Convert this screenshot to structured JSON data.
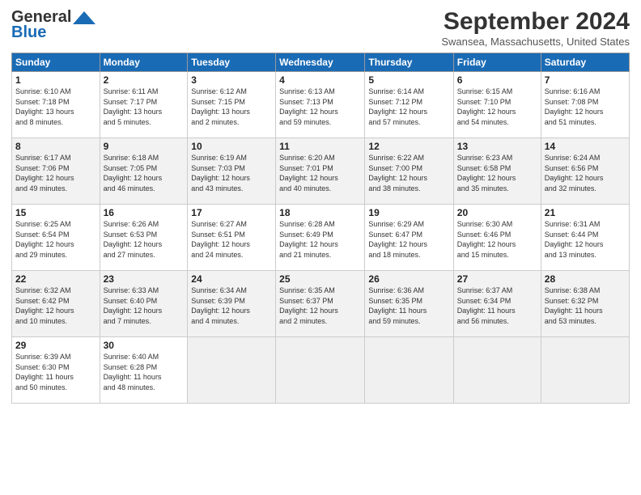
{
  "logo": {
    "line1": "General",
    "line2": "Blue"
  },
  "title": "September 2024",
  "subtitle": "Swansea, Massachusetts, United States",
  "weekdays": [
    "Sunday",
    "Monday",
    "Tuesday",
    "Wednesday",
    "Thursday",
    "Friday",
    "Saturday"
  ],
  "weeks": [
    [
      {
        "day": "1",
        "info": "Sunrise: 6:10 AM\nSunset: 7:18 PM\nDaylight: 13 hours\nand 8 minutes."
      },
      {
        "day": "2",
        "info": "Sunrise: 6:11 AM\nSunset: 7:17 PM\nDaylight: 13 hours\nand 5 minutes."
      },
      {
        "day": "3",
        "info": "Sunrise: 6:12 AM\nSunset: 7:15 PM\nDaylight: 13 hours\nand 2 minutes."
      },
      {
        "day": "4",
        "info": "Sunrise: 6:13 AM\nSunset: 7:13 PM\nDaylight: 12 hours\nand 59 minutes."
      },
      {
        "day": "5",
        "info": "Sunrise: 6:14 AM\nSunset: 7:12 PM\nDaylight: 12 hours\nand 57 minutes."
      },
      {
        "day": "6",
        "info": "Sunrise: 6:15 AM\nSunset: 7:10 PM\nDaylight: 12 hours\nand 54 minutes."
      },
      {
        "day": "7",
        "info": "Sunrise: 6:16 AM\nSunset: 7:08 PM\nDaylight: 12 hours\nand 51 minutes."
      }
    ],
    [
      {
        "day": "8",
        "info": "Sunrise: 6:17 AM\nSunset: 7:06 PM\nDaylight: 12 hours\nand 49 minutes."
      },
      {
        "day": "9",
        "info": "Sunrise: 6:18 AM\nSunset: 7:05 PM\nDaylight: 12 hours\nand 46 minutes."
      },
      {
        "day": "10",
        "info": "Sunrise: 6:19 AM\nSunset: 7:03 PM\nDaylight: 12 hours\nand 43 minutes."
      },
      {
        "day": "11",
        "info": "Sunrise: 6:20 AM\nSunset: 7:01 PM\nDaylight: 12 hours\nand 40 minutes."
      },
      {
        "day": "12",
        "info": "Sunrise: 6:22 AM\nSunset: 7:00 PM\nDaylight: 12 hours\nand 38 minutes."
      },
      {
        "day": "13",
        "info": "Sunrise: 6:23 AM\nSunset: 6:58 PM\nDaylight: 12 hours\nand 35 minutes."
      },
      {
        "day": "14",
        "info": "Sunrise: 6:24 AM\nSunset: 6:56 PM\nDaylight: 12 hours\nand 32 minutes."
      }
    ],
    [
      {
        "day": "15",
        "info": "Sunrise: 6:25 AM\nSunset: 6:54 PM\nDaylight: 12 hours\nand 29 minutes."
      },
      {
        "day": "16",
        "info": "Sunrise: 6:26 AM\nSunset: 6:53 PM\nDaylight: 12 hours\nand 27 minutes."
      },
      {
        "day": "17",
        "info": "Sunrise: 6:27 AM\nSunset: 6:51 PM\nDaylight: 12 hours\nand 24 minutes."
      },
      {
        "day": "18",
        "info": "Sunrise: 6:28 AM\nSunset: 6:49 PM\nDaylight: 12 hours\nand 21 minutes."
      },
      {
        "day": "19",
        "info": "Sunrise: 6:29 AM\nSunset: 6:47 PM\nDaylight: 12 hours\nand 18 minutes."
      },
      {
        "day": "20",
        "info": "Sunrise: 6:30 AM\nSunset: 6:46 PM\nDaylight: 12 hours\nand 15 minutes."
      },
      {
        "day": "21",
        "info": "Sunrise: 6:31 AM\nSunset: 6:44 PM\nDaylight: 12 hours\nand 13 minutes."
      }
    ],
    [
      {
        "day": "22",
        "info": "Sunrise: 6:32 AM\nSunset: 6:42 PM\nDaylight: 12 hours\nand 10 minutes."
      },
      {
        "day": "23",
        "info": "Sunrise: 6:33 AM\nSunset: 6:40 PM\nDaylight: 12 hours\nand 7 minutes."
      },
      {
        "day": "24",
        "info": "Sunrise: 6:34 AM\nSunset: 6:39 PM\nDaylight: 12 hours\nand 4 minutes."
      },
      {
        "day": "25",
        "info": "Sunrise: 6:35 AM\nSunset: 6:37 PM\nDaylight: 12 hours\nand 2 minutes."
      },
      {
        "day": "26",
        "info": "Sunrise: 6:36 AM\nSunset: 6:35 PM\nDaylight: 11 hours\nand 59 minutes."
      },
      {
        "day": "27",
        "info": "Sunrise: 6:37 AM\nSunset: 6:34 PM\nDaylight: 11 hours\nand 56 minutes."
      },
      {
        "day": "28",
        "info": "Sunrise: 6:38 AM\nSunset: 6:32 PM\nDaylight: 11 hours\nand 53 minutes."
      }
    ],
    [
      {
        "day": "29",
        "info": "Sunrise: 6:39 AM\nSunset: 6:30 PM\nDaylight: 11 hours\nand 50 minutes."
      },
      {
        "day": "30",
        "info": "Sunrise: 6:40 AM\nSunset: 6:28 PM\nDaylight: 11 hours\nand 48 minutes."
      },
      null,
      null,
      null,
      null,
      null
    ]
  ]
}
